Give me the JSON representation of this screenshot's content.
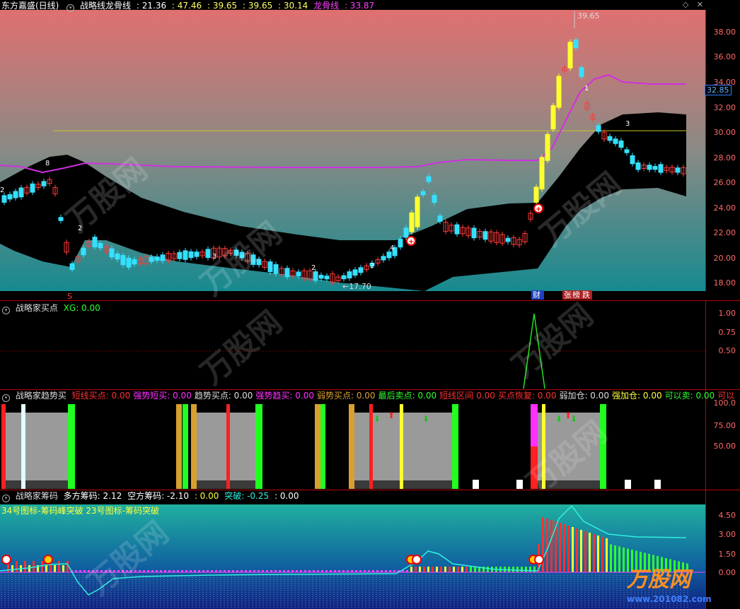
{
  "main": {
    "title": "东方嘉盛(日线)",
    "indicator": "战略线龙骨线",
    "vals": [
      ": 21.36",
      ": 47.46",
      ": 39.65",
      ": 39.65",
      ": 30.14"
    ],
    "dragon_label": "龙骨线",
    "dragon_val": ": 33.87",
    "ticks": [
      "38.00",
      "36.00",
      "34.00",
      "32.00",
      "30.00",
      "28.00",
      "26.00",
      "24.00",
      "22.00",
      "20.00",
      "18.00"
    ],
    "price_box": "32.85",
    "hi_label": "39.65",
    "lo_label": "17.70",
    "tags": {
      "cai": "财",
      "zhang": "张",
      "bang": "榜",
      "die": "跌"
    },
    "nums": [
      "2",
      "8",
      "2",
      "3",
      "2",
      "2",
      "4",
      "1",
      "3"
    ]
  },
  "p2": {
    "title": "战略家买点",
    "xg": "XG: 0.00",
    "ticks": [
      "1.00",
      "0.75",
      "0.50"
    ]
  },
  "p3": {
    "title": "战略家趋势买",
    "items": [
      {
        "t": "短线买点: 0.00",
        "c": "#ff3030"
      },
      {
        "t": "强势短买: 0.00",
        "c": "#ff30ff"
      },
      {
        "t": "趋势买点: 0.00",
        "c": "#dddddd"
      },
      {
        "t": "强势趋买: 0.00",
        "c": "#ff30ff"
      },
      {
        "t": "弱势买点: 0.00",
        "c": "#d9a030"
      },
      {
        "t": "最后卖点: 0.00",
        "c": "#30ff30"
      },
      {
        "t": "短线区间",
        "c": "#ff3030"
      },
      {
        "t": "0.00",
        "c": "#ff3030"
      },
      {
        "t": "买点恢复: 0.00",
        "c": "#ff3030"
      },
      {
        "t": "弱加仓: 0.00",
        "c": "#dddddd"
      },
      {
        "t": "强加仓: 0.00",
        "c": "#ffff40"
      },
      {
        "t": "可以卖: 0.00",
        "c": "#30ff30"
      },
      {
        "t": "可以",
        "c": "#ff3030"
      }
    ],
    "ticks": [
      "100.0",
      "75.00",
      "50.00"
    ]
  },
  "p4": {
    "title": "战略家筹码",
    "duo": "多方筹码: 2.12",
    "kong": "空方筹码: -2.10",
    "v1": ": 0.00",
    "tupo": "突破: -0.25",
    "v2": ": 0.00",
    "line2": "34号图标-筹码峰突破 23号图标-筹码突破",
    "ticks": [
      "4.50",
      "3.00",
      "1.50",
      "0.00"
    ]
  },
  "watermark": {
    "brand": "万股网",
    "url": "www.201082.com"
  },
  "colors": {
    "up": "#ff3b3b",
    "down": "#35e0ff",
    "yellow": "#ffff30",
    "magenta": "#e040e0",
    "green": "#30ff30",
    "orange": "#d9a030"
  }
}
